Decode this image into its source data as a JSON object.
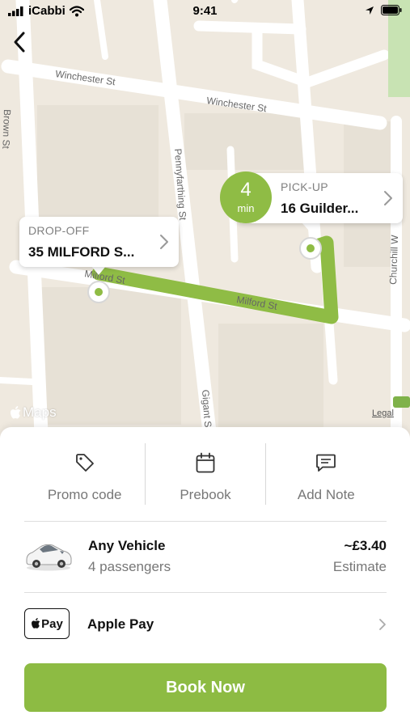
{
  "status_bar": {
    "carrier": "iCabbi",
    "time": "9:41"
  },
  "map": {
    "streets": {
      "winchester_1": "Winchester St",
      "winchester_2": "Winchester St",
      "brown": "Brown St",
      "pennyfarthing": "Pennyfarthing St",
      "milford_1": "Milford St",
      "milford_2": "Milford St",
      "gigant": "Gigant St",
      "churchill": "Churchill W"
    },
    "route_color": "#8fbc45",
    "maps_label": "Maps",
    "legal_label": "Legal"
  },
  "pickup": {
    "label": "PICK-UP",
    "address": "16 Guilder..."
  },
  "dropoff": {
    "label": "DROP-OFF",
    "address": "35 MILFORD S..."
  },
  "eta": {
    "value": "4",
    "unit": "min"
  },
  "actions": [
    {
      "label": "Promo code",
      "icon": "tag-icon"
    },
    {
      "label": "Prebook",
      "icon": "calendar-icon"
    },
    {
      "label": "Add Note",
      "icon": "note-icon"
    }
  ],
  "vehicle": {
    "name": "Any Vehicle",
    "passengers": "4 passengers",
    "price": "~£3.40",
    "price_note": "Estimate"
  },
  "payment": {
    "badge_text": "Pay",
    "method": "Apple Pay"
  },
  "book_button": {
    "label": "Book Now",
    "color": "#8dbb43"
  }
}
